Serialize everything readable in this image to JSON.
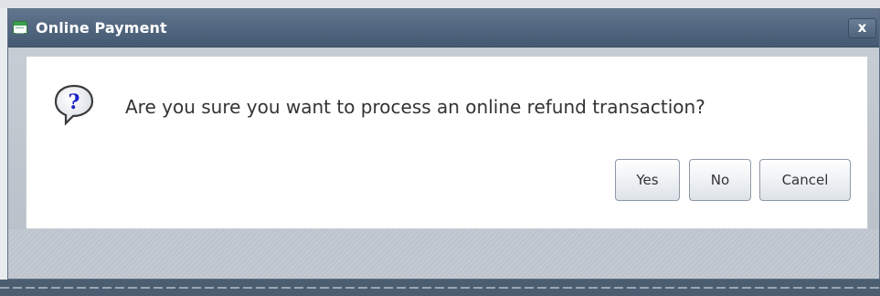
{
  "dialog": {
    "title": "Online Payment",
    "close_label": "x",
    "message": "Are you sure you want to process an online refund transaction?",
    "icon": "question-icon",
    "buttons": {
      "yes": "Yes",
      "no": "No",
      "cancel": "Cancel"
    }
  }
}
